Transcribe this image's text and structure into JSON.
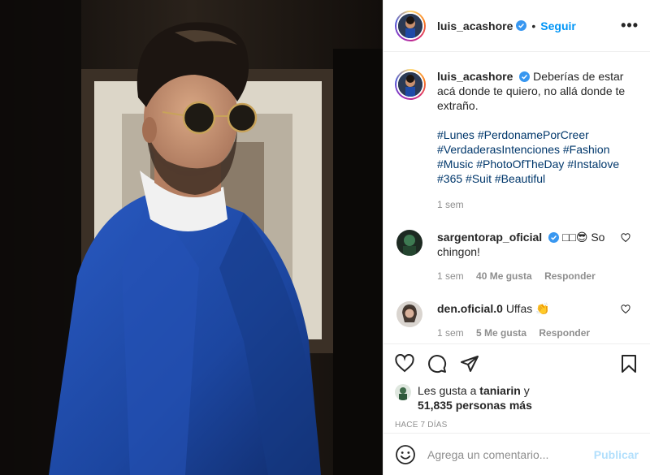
{
  "post": {
    "photo_alt": "Man in blue suit wearing round sunglasses",
    "author": "luis_acashore",
    "verified": true,
    "separator": "•",
    "follow_label": "Seguir",
    "more_label": "•••"
  },
  "caption": {
    "username": "luis_acashore",
    "text": "Deberías de estar acá donde te quiero, no allá donde te extraño.",
    "hashtags": [
      "#Lunes",
      "#PerdonamePorCreer",
      "#VerdaderasIntenciones",
      "#Fashion",
      "#Music",
      "#PhotoOfTheDay",
      "#Instalove",
      "#365",
      "#Suit",
      "#Beautiful"
    ],
    "time": "1 sem"
  },
  "comments": [
    {
      "username": "sargentorap_oficial",
      "verified": true,
      "text": "□□😎 So chingon!",
      "time": "1 sem",
      "likes": "40 Me gusta",
      "reply": "Responder"
    },
    {
      "username": "den.oficial.0",
      "verified": false,
      "text": "Uffas 👏",
      "time": "1 sem",
      "likes": "5 Me gusta",
      "reply": "Responder"
    }
  ],
  "likes": {
    "prefix": "Les gusta a",
    "first_user": "taniarin",
    "connector": "y",
    "others": "51,835 personas más"
  },
  "date": "HACE 7 DÍAS",
  "add_comment": {
    "emoji_icon": "smiley-icon",
    "placeholder": "Agrega un comentario...",
    "publish_label": "Publicar"
  },
  "colors": {
    "link_blue": "#0095f6",
    "hashtag": "#00376b",
    "muted": "#8e8e8e",
    "publish_disabled": "#b2dffc",
    "suit": "#1f4aa8"
  }
}
